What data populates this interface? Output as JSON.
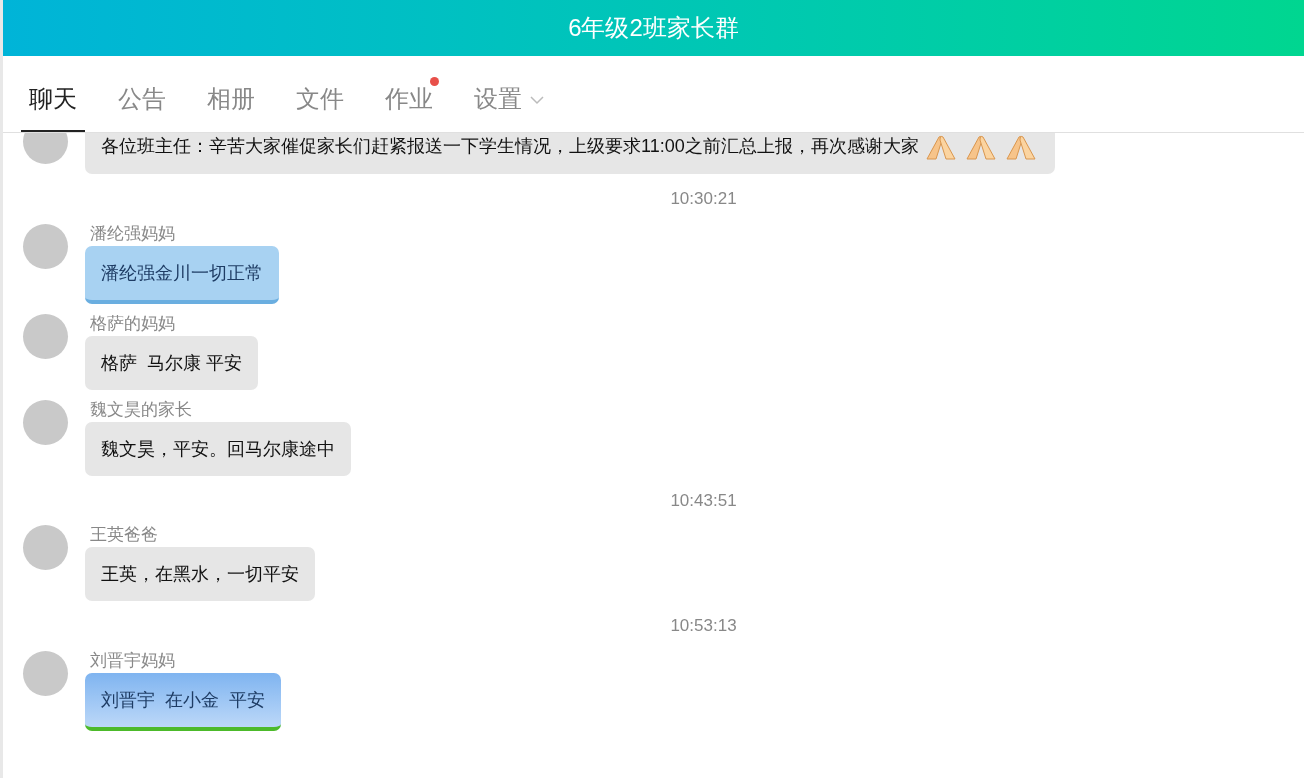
{
  "header": {
    "title": "6年级2班家长群"
  },
  "tabs": [
    {
      "label": "聊天",
      "selected": true,
      "badge": false,
      "dropdown": false
    },
    {
      "label": "公告",
      "selected": false,
      "badge": false,
      "dropdown": false
    },
    {
      "label": "相册",
      "selected": false,
      "badge": false,
      "dropdown": false
    },
    {
      "label": "文件",
      "selected": false,
      "badge": false,
      "dropdown": false
    },
    {
      "label": "作业",
      "selected": false,
      "badge": true,
      "dropdown": false
    },
    {
      "label": "设置",
      "selected": false,
      "badge": false,
      "dropdown": true
    }
  ],
  "messages": [
    {
      "kind": "plain",
      "text": "各位班主任：辛苦大家催促家长们赶紧报送一下学生情况，上级要求11:00之前汇总上报，再次感谢大家"
    },
    {
      "kind": "time",
      "text": "10:30:21"
    },
    {
      "kind": "cloud",
      "sender": "潘纶强妈妈",
      "text": "潘纶强金川一切正常"
    },
    {
      "kind": "plain",
      "sender": "格萨的妈妈",
      "text": "格萨  马尔康 平安"
    },
    {
      "kind": "plain",
      "sender": "魏文昊的家长",
      "text": "魏文昊，平安。回马尔康途中"
    },
    {
      "kind": "time",
      "text": "10:43:51"
    },
    {
      "kind": "plain",
      "sender": "王英爸爸",
      "text": "王英，在黑水，一切平安"
    },
    {
      "kind": "time",
      "text": "10:53:13"
    },
    {
      "kind": "kite",
      "sender": "刘晋宇妈妈",
      "text": "刘晋宇  在小金  平安"
    }
  ]
}
